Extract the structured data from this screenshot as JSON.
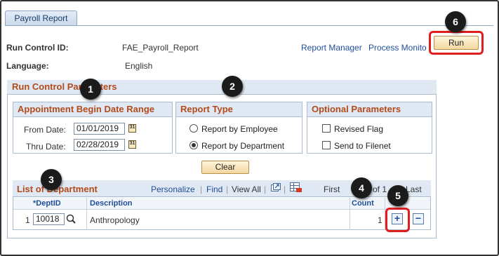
{
  "tab": {
    "label": "Payroll Report"
  },
  "header": {
    "run_control_label": "Run Control ID:",
    "run_control_value": "FAE_Payroll_Report",
    "language_label": "Language:",
    "language_value": "English",
    "report_manager_link": "Report Manager",
    "process_monitor_link": "Process Monito",
    "run_button": "Run"
  },
  "params": {
    "title": "Run Control Parameters",
    "date_range": {
      "title": "Appointment Begin Date Range",
      "from_label": "From Date:",
      "from_value": "01/01/2019",
      "thru_label": "Thru Date:",
      "thru_value": "02/28/2019"
    },
    "report_type": {
      "title": "Report Type",
      "options": [
        "Report by Employee",
        "Report by Department"
      ],
      "selected": "Report by Department"
    },
    "optional": {
      "title": "Optional Parameters",
      "options": [
        "Revised Flag",
        "Send to Filenet"
      ]
    },
    "clear_button": "Clear"
  },
  "grid": {
    "title": "List of Department",
    "personalize": "Personalize",
    "find": "Find",
    "view_all": "View All",
    "first": "First",
    "pagination": "of 1",
    "last": "Last",
    "columns": [
      "*DeptID",
      "Description",
      "Count"
    ],
    "rows": [
      {
        "num": "1",
        "dept_id": "10018",
        "description": "Anthropology",
        "count": "1"
      }
    ],
    "add_symbol": "+",
    "delete_symbol": "−"
  },
  "callouts": [
    "1",
    "2",
    "3",
    "4",
    "5",
    "6"
  ],
  "colors": {
    "accent_red": "#e01e1e",
    "section_title": "#b34a1a",
    "link": "#1f4d9a"
  }
}
